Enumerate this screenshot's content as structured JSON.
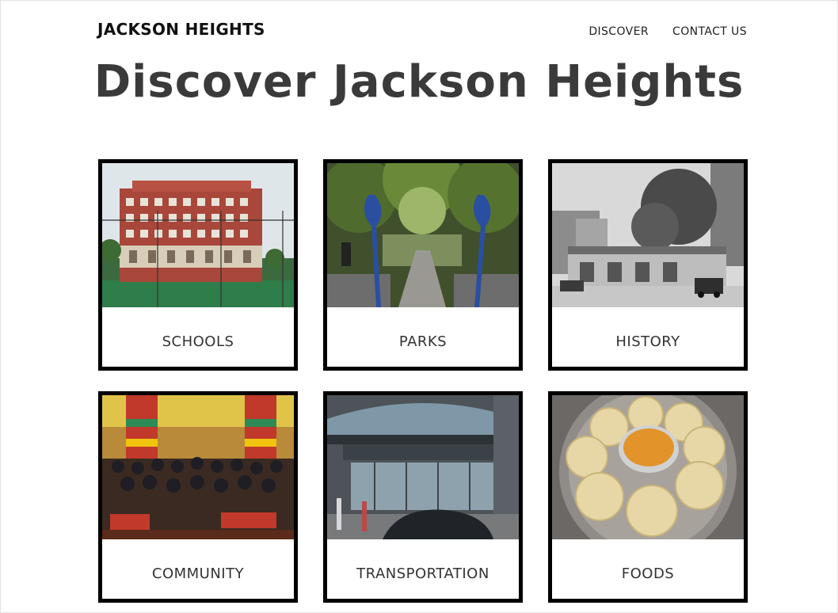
{
  "header": {
    "brand": "JACKSON HEIGHTS",
    "nav": [
      {
        "label": "DISCOVER"
      },
      {
        "label": "CONTACT US"
      }
    ]
  },
  "hero": {
    "title": "Discover Jackson Heights"
  },
  "cards": [
    {
      "label": "SCHOOLS",
      "image": "school-building-photo"
    },
    {
      "label": "PARKS",
      "image": "park-gate-photo"
    },
    {
      "label": "HISTORY",
      "image": "historic-street-photo"
    },
    {
      "label": "COMMUNITY",
      "image": "community-gathering-photo"
    },
    {
      "label": "TRANSPORTATION",
      "image": "subway-station-photo"
    },
    {
      "label": "FOODS",
      "image": "momo-dumplings-photo"
    }
  ]
}
